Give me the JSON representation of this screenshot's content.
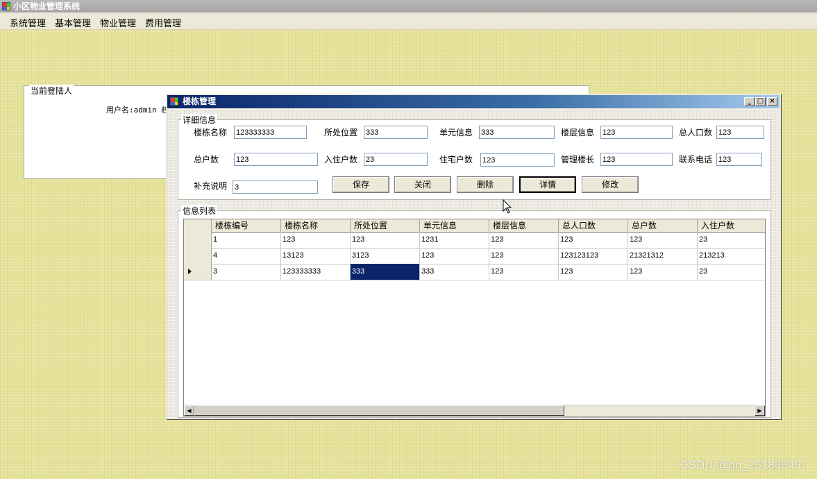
{
  "app": {
    "title": "小区物业管理系统"
  },
  "menu": [
    "系统管理",
    "基本管理",
    "物业管理",
    "费用管理"
  ],
  "login_panel": {
    "legend": "当前登陆人",
    "user_text": "用户名:admin 权"
  },
  "window": {
    "title": "楼栋管理",
    "controls": {
      "minimize": "_",
      "maximize": "□",
      "close": "×"
    }
  },
  "details": {
    "legend": "详细信息",
    "fields": {
      "building_name": {
        "label": "楼栋名称",
        "value": "123333333"
      },
      "location": {
        "label": "所处位置",
        "value": "333"
      },
      "unit_info": {
        "label": "单元信息",
        "value": "333"
      },
      "floor_info": {
        "label": "楼层信息",
        "value": "123"
      },
      "total_population": {
        "label": "总人口数",
        "value": "123"
      },
      "total_households": {
        "label": "总户数",
        "value": "123"
      },
      "occupied_households": {
        "label": "入住户数",
        "value": "23"
      },
      "residential_households": {
        "label": "住宅户数",
        "value": "123"
      },
      "building_manager": {
        "label": "管理楼长",
        "value": "123"
      },
      "phone": {
        "label": "联系电话",
        "value": "123"
      },
      "notes": {
        "label": "补充说明",
        "value": "3"
      }
    },
    "buttons": {
      "save": "保存",
      "close": "关闭",
      "delete": "删除",
      "details": "详情",
      "modify": "修改"
    }
  },
  "list": {
    "legend": "信息列表",
    "columns": [
      "楼栋编号",
      "楼栋名称",
      "所处位置",
      "单元信息",
      "楼层信息",
      "总人口数",
      "总户数",
      "入住户数"
    ],
    "rows": [
      [
        "1",
        "123",
        "123",
        "1231",
        "123",
        "123",
        "123",
        "23"
      ],
      [
        "4",
        "13123",
        "3123",
        "123",
        "123",
        "123123123",
        "21321312",
        "213213"
      ],
      [
        "3",
        "123333333",
        "333",
        "333",
        "123",
        "123",
        "123",
        "23"
      ]
    ],
    "scroll": {
      "left": "◀",
      "right": "▶"
    }
  },
  "watermark": "CSDN @qq_251836457"
}
